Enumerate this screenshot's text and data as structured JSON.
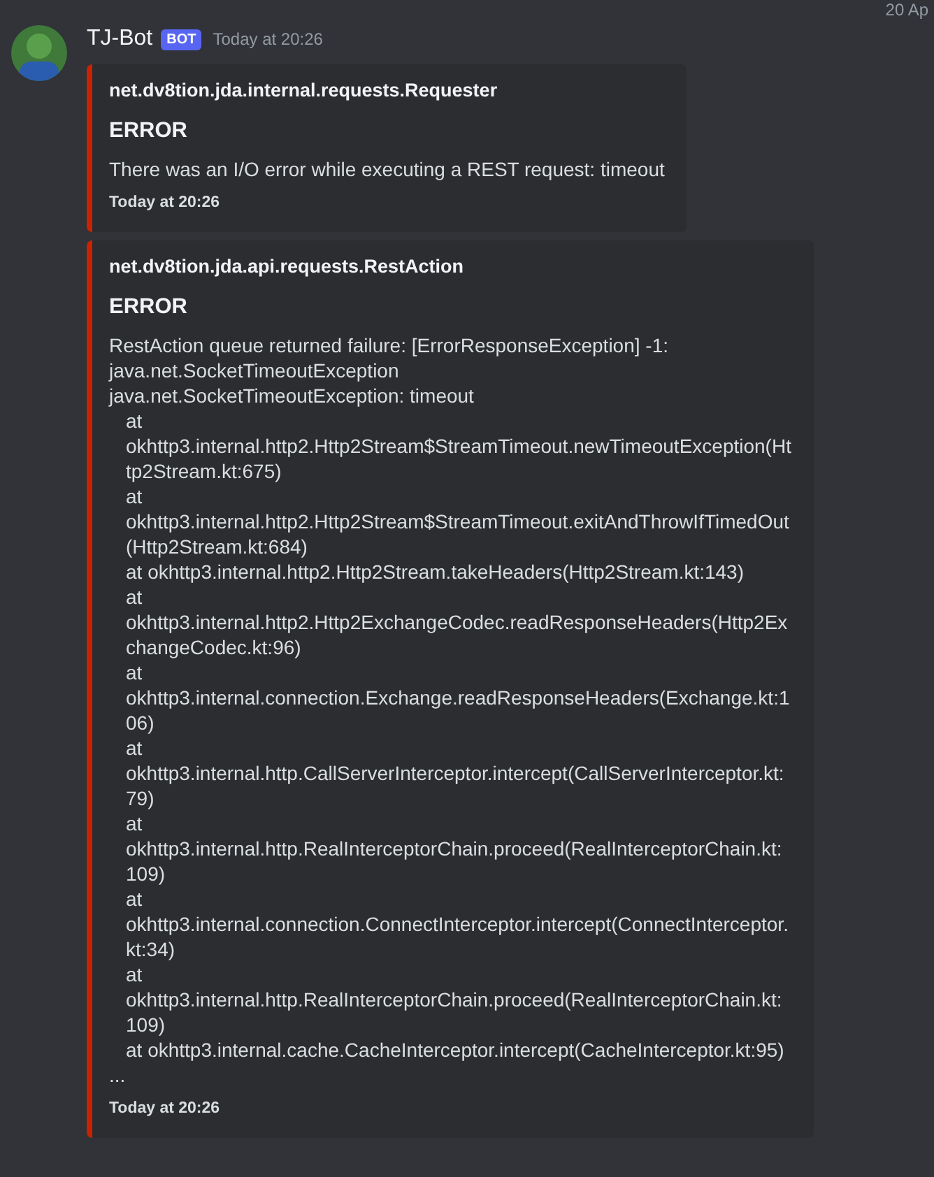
{
  "corner_date": "20 Ap",
  "message": {
    "author": "TJ-Bot",
    "badge": "BOT",
    "timestamp": "Today at 20:26",
    "embeds": [
      {
        "color": "#cc2200",
        "author": "net.dv8tion.jda.internal.requests.Requester",
        "title": "ERROR",
        "description": [
          "There was an I/O error while executing a REST request: timeout"
        ],
        "footer": "Today at 20:26"
      },
      {
        "color": "#cc2200",
        "author": "net.dv8tion.jda.api.requests.RestAction",
        "title": "ERROR",
        "description": [
          "RestAction queue returned failure: [ErrorResponseException] -1: java.net.SocketTimeoutException",
          "java.net.SocketTimeoutException: timeout"
        ],
        "trace": [
          "at okhttp3.internal.http2.Http2Stream$StreamTimeout.newTimeoutException(Http2Stream.kt:675)",
          "at okhttp3.internal.http2.Http2Stream$StreamTimeout.exitAndThrowIfTimedOut(Http2Stream.kt:684)",
          "at okhttp3.internal.http2.Http2Stream.takeHeaders(Http2Stream.kt:143)",
          "at okhttp3.internal.http2.Http2ExchangeCodec.readResponseHeaders(Http2ExchangeCodec.kt:96)",
          "at okhttp3.internal.connection.Exchange.readResponseHeaders(Exchange.kt:106)",
          "at okhttp3.internal.http.CallServerInterceptor.intercept(CallServerInterceptor.kt:79)",
          "at okhttp3.internal.http.RealInterceptorChain.proceed(RealInterceptorChain.kt:109)",
          "at okhttp3.internal.connection.ConnectInterceptor.intercept(ConnectInterceptor.kt:34)",
          "at okhttp3.internal.http.RealInterceptorChain.proceed(RealInterceptorChain.kt:109)",
          "at okhttp3.internal.cache.CacheInterceptor.intercept(CacheInterceptor.kt:95)"
        ],
        "ellipsis": "...",
        "footer": "Today at 20:26"
      }
    ]
  }
}
